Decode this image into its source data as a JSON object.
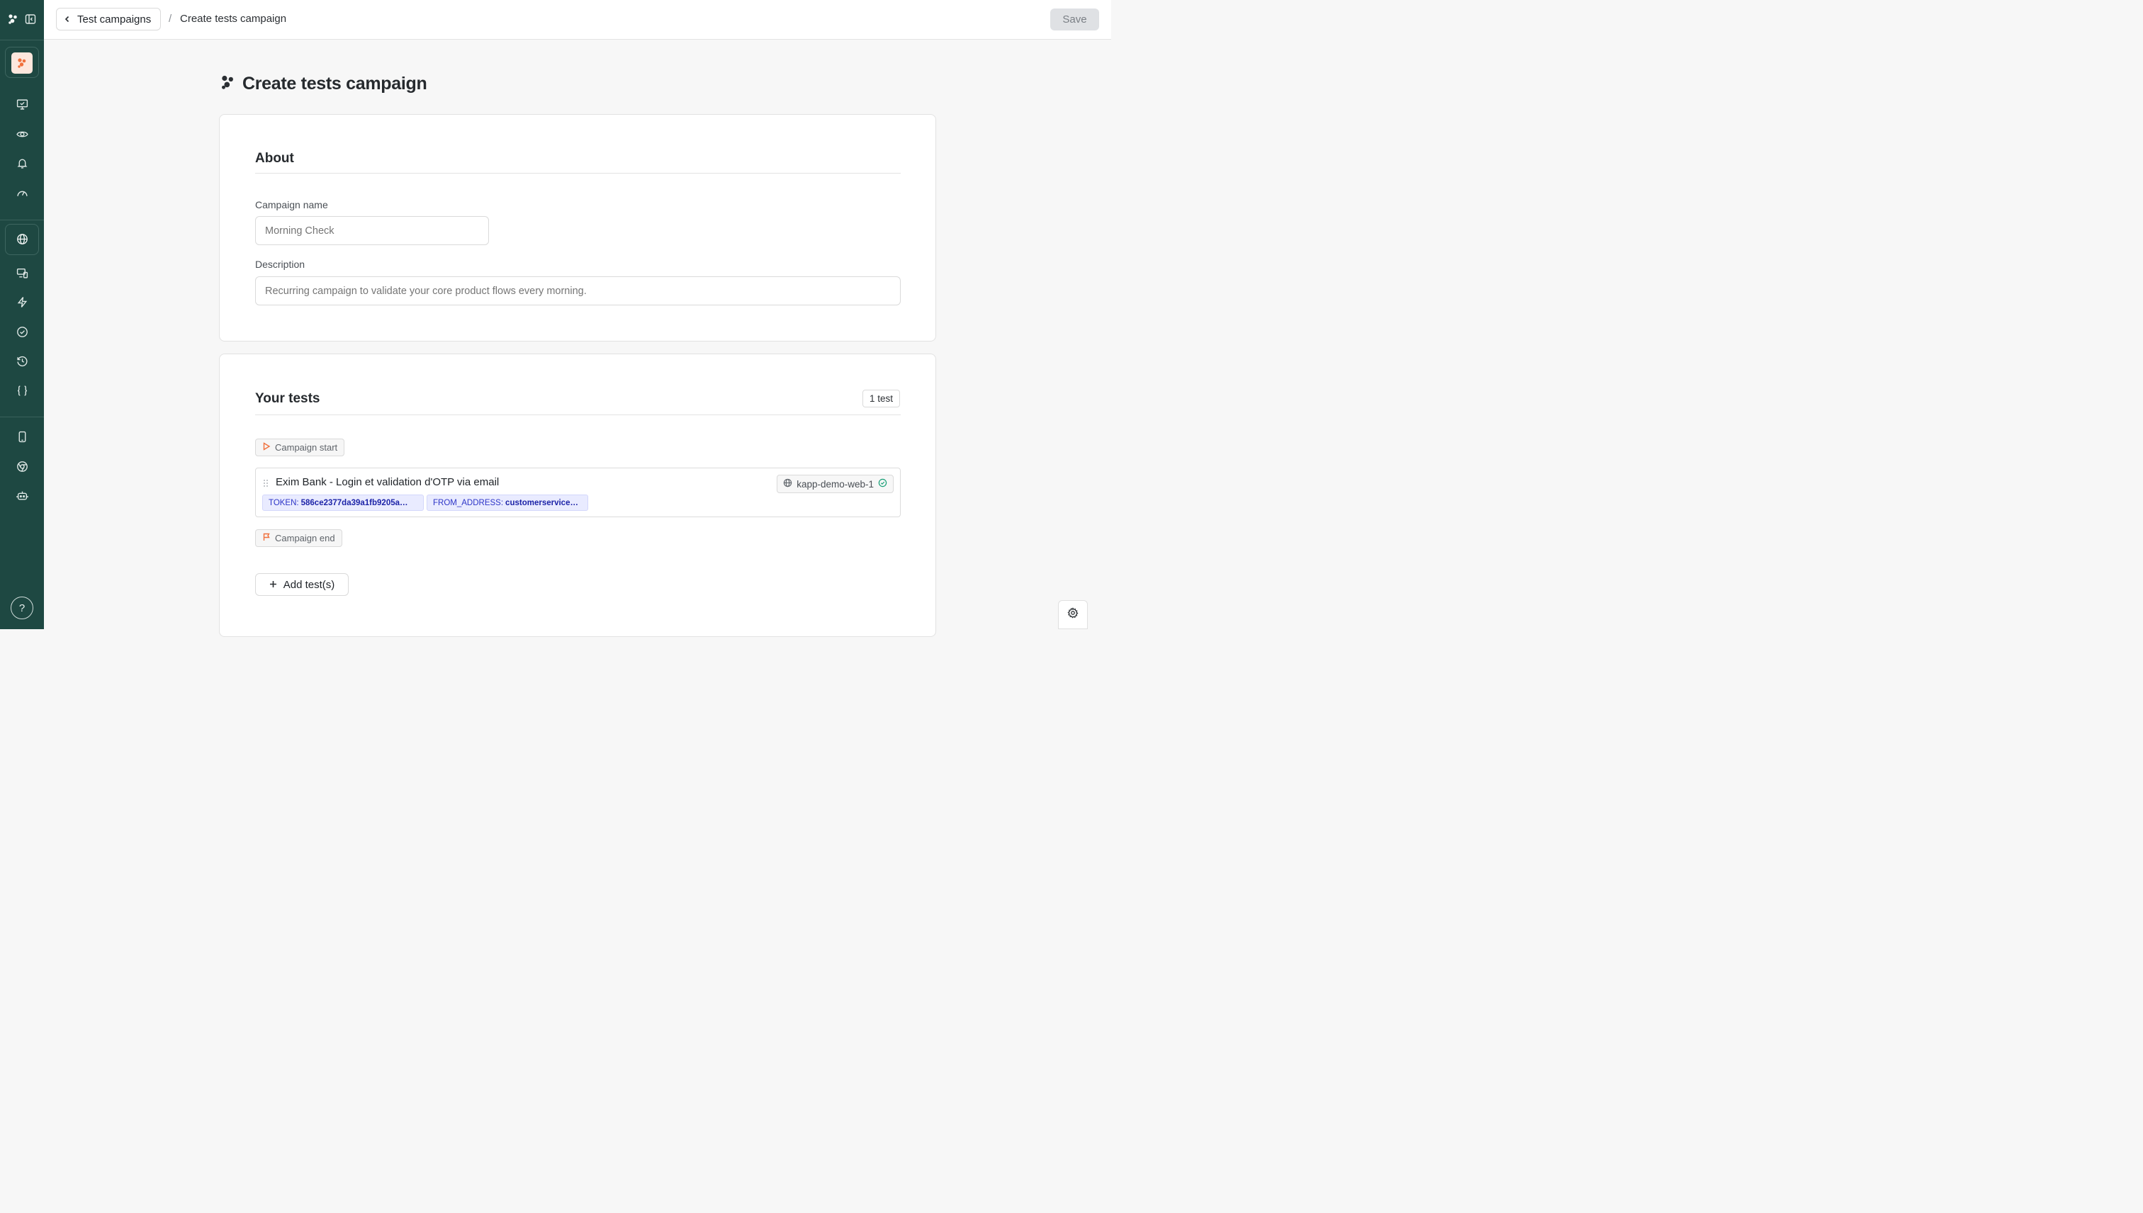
{
  "header": {
    "back_label": "Test campaigns",
    "separator": "/",
    "current_page": "Create tests campaign",
    "save_label": "Save"
  },
  "page": {
    "title": "Create tests campaign"
  },
  "about": {
    "title": "About",
    "campaign_name_label": "Campaign name",
    "campaign_name_placeholder": "Morning Check",
    "campaign_name_value": "",
    "description_label": "Description",
    "description_placeholder": "Recurring campaign to validate your core product flows every morning.",
    "description_value": ""
  },
  "tests": {
    "title": "Your tests",
    "count_label": "1 test",
    "start_label": "Campaign start",
    "end_label": "Campaign end",
    "items": [
      {
        "name": "Exim Bank - Login et validation d'OTP via email",
        "variables": [
          {
            "key": "TOKEN:",
            "value": "586ce2377da39a1fb9205a…"
          },
          {
            "key": "FROM_ADDRESS:",
            "value": "customerservice…"
          }
        ],
        "environment": "kapp-demo-web-1"
      }
    ],
    "add_label": "Add test(s)"
  },
  "sidebar": {
    "help_label": "?",
    "icons": [
      "logo-icon",
      "sidebar-toggle-icon",
      "app-logo-icon",
      "monitor-check-icon",
      "eye-icon",
      "bell-icon",
      "gauge-icon",
      "globe-icon",
      "devices-icon",
      "bolt-icon",
      "check-circle-icon",
      "history-icon",
      "braces-icon",
      "mobile-icon",
      "chrome-icon",
      "robot-icon",
      "help-icon"
    ]
  },
  "colors": {
    "sidebar": "#1e4842",
    "accent": "#f0703c",
    "variable_chip": "#e9ebff",
    "success": "#1aa078"
  }
}
